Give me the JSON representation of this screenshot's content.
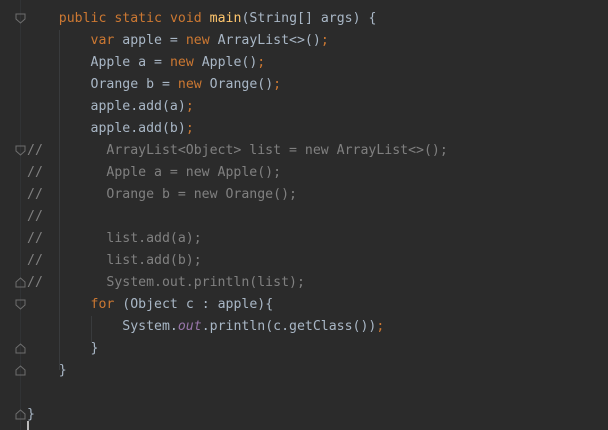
{
  "editor": {
    "lines": [
      {
        "indent": "    ",
        "tokens": [
          {
            "t": "public",
            "c": "kw"
          },
          {
            "t": " ",
            "c": "pl"
          },
          {
            "t": "static",
            "c": "kw"
          },
          {
            "t": " ",
            "c": "pl"
          },
          {
            "t": "void",
            "c": "kw"
          },
          {
            "t": " ",
            "c": "pl"
          },
          {
            "t": "main",
            "c": "fn"
          },
          {
            "t": "(String[] args) {",
            "c": "pl"
          }
        ]
      },
      {
        "indent": "        ",
        "tokens": [
          {
            "t": "var",
            "c": "kw"
          },
          {
            "t": " apple = ",
            "c": "pl"
          },
          {
            "t": "new",
            "c": "kw"
          },
          {
            "t": " ArrayList<>()",
            "c": "pl"
          },
          {
            "t": ";",
            "c": "kw"
          }
        ]
      },
      {
        "indent": "        ",
        "tokens": [
          {
            "t": "Apple a = ",
            "c": "pl"
          },
          {
            "t": "new",
            "c": "kw"
          },
          {
            "t": " Apple()",
            "c": "pl"
          },
          {
            "t": ";",
            "c": "kw"
          }
        ]
      },
      {
        "indent": "        ",
        "tokens": [
          {
            "t": "Orange b = ",
            "c": "pl"
          },
          {
            "t": "new",
            "c": "kw"
          },
          {
            "t": " Orange()",
            "c": "pl"
          },
          {
            "t": ";",
            "c": "kw"
          }
        ]
      },
      {
        "indent": "        ",
        "tokens": [
          {
            "t": "apple.add(a)",
            "c": "pl"
          },
          {
            "t": ";",
            "c": "kw"
          }
        ]
      },
      {
        "indent": "        ",
        "tokens": [
          {
            "t": "apple.add(b)",
            "c": "pl"
          },
          {
            "t": ";",
            "c": "kw"
          }
        ]
      },
      {
        "indent": "",
        "tokens": [
          {
            "t": "//        ArrayList<Object> list = new ArrayList<>();",
            "c": "cm"
          }
        ]
      },
      {
        "indent": "",
        "tokens": [
          {
            "t": "//        Apple a = new Apple();",
            "c": "cm"
          }
        ]
      },
      {
        "indent": "",
        "tokens": [
          {
            "t": "//        Orange b = new Orange();",
            "c": "cm"
          }
        ]
      },
      {
        "indent": "",
        "tokens": [
          {
            "t": "//",
            "c": "cm"
          }
        ]
      },
      {
        "indent": "",
        "tokens": [
          {
            "t": "//        list.add(a);",
            "c": "cm"
          }
        ]
      },
      {
        "indent": "",
        "tokens": [
          {
            "t": "//        list.add(b);",
            "c": "cm"
          }
        ]
      },
      {
        "indent": "",
        "tokens": [
          {
            "t": "//        System.out.println(list);",
            "c": "cm"
          }
        ]
      },
      {
        "indent": "        ",
        "tokens": [
          {
            "t": "for",
            "c": "kw"
          },
          {
            "t": " (Object c : apple){",
            "c": "pl"
          }
        ]
      },
      {
        "indent": "            ",
        "tokens": [
          {
            "t": "System.",
            "c": "pl"
          },
          {
            "t": "out",
            "c": "it"
          },
          {
            "t": ".println(c.getClass())",
            "c": "pl"
          },
          {
            "t": ";",
            "c": "kw"
          }
        ]
      },
      {
        "indent": "        ",
        "tokens": [
          {
            "t": "}",
            "c": "pl"
          }
        ]
      },
      {
        "indent": "    ",
        "tokens": [
          {
            "t": "}",
            "c": "pl"
          }
        ]
      },
      {
        "indent": "",
        "tokens": []
      },
      {
        "indent": "",
        "tokens": [
          {
            "t": "}",
            "c": "pl"
          }
        ]
      }
    ]
  }
}
